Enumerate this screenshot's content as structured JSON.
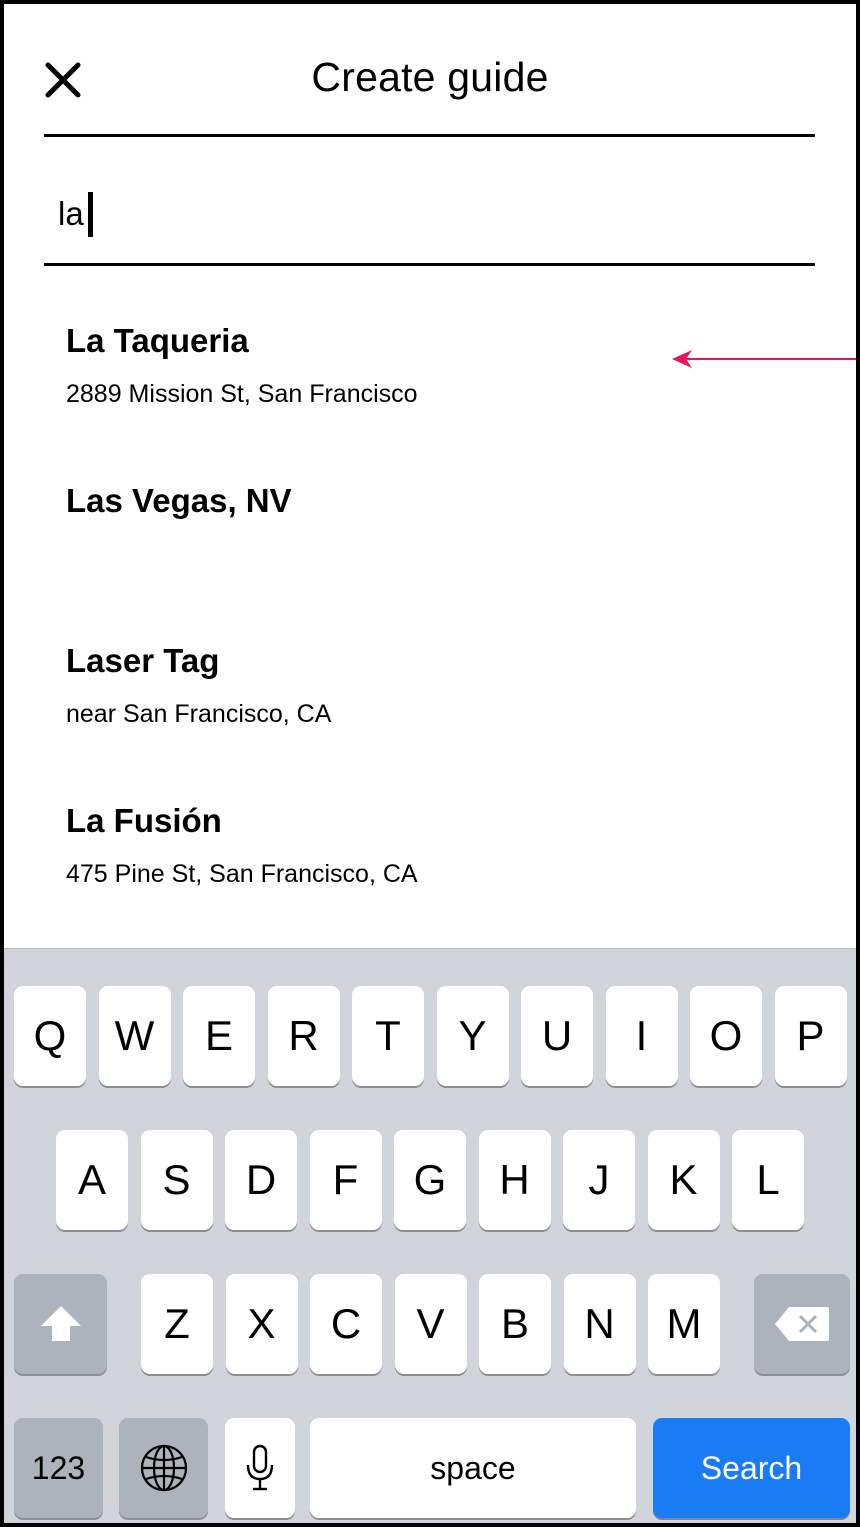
{
  "header": {
    "title": "Create guide"
  },
  "search": {
    "value": "la"
  },
  "results": [
    {
      "title": "La Taqueria",
      "subtitle": "2889 Mission St, San Francisco"
    },
    {
      "title": "Las Vegas, NV",
      "subtitle": ""
    },
    {
      "title": "Laser Tag",
      "subtitle": "near San Francisco, CA"
    },
    {
      "title": "La Fusión",
      "subtitle": "475 Pine St, San Francisco, CA"
    }
  ],
  "annotation": {
    "arrow_color": "#e8155e"
  },
  "keyboard": {
    "row1": [
      "Q",
      "W",
      "E",
      "R",
      "T",
      "Y",
      "U",
      "I",
      "O",
      "P"
    ],
    "row2": [
      "A",
      "S",
      "D",
      "F",
      "G",
      "H",
      "J",
      "K",
      "L"
    ],
    "row3": [
      "Z",
      "X",
      "C",
      "V",
      "B",
      "N",
      "M"
    ],
    "numbers_label": "123",
    "space_label": "space",
    "action_label": "Search",
    "action_color": "#1a7cf5",
    "icons": [
      "shift-icon",
      "backspace-icon",
      "globe-icon",
      "microphone-icon"
    ]
  }
}
